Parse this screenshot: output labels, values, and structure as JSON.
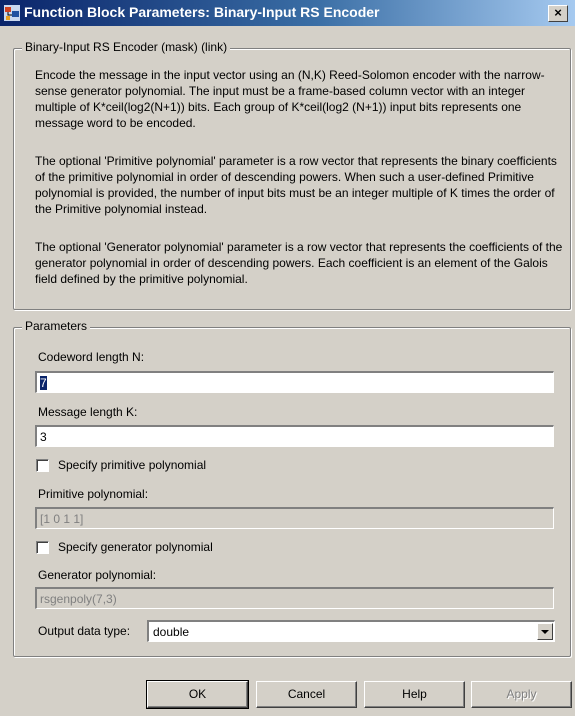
{
  "window": {
    "title": "Function Block Parameters: Binary-Input RS Encoder",
    "close_label": "×"
  },
  "description": {
    "group_label": "Binary-Input RS Encoder (mask) (link)",
    "paragraphs": [
      "Encode the message in the input vector using an (N,K) Reed-Solomon encoder with the narrow-sense generator polynomial.  The input must be a frame-based column vector with an integer multiple of K*ceil(log2(N+1)) bits.  Each group of K*ceil(log2 (N+1)) input bits represents one message word to be encoded.",
      "The optional 'Primitive polynomial' parameter is a row vector that represents the binary coefficients of the primitive polynomial in order of descending powers.  When such a user-defined Primitive polynomial is provided, the number of input bits must be an integer multiple of K times the order of the Primitive polynomial instead.",
      "The optional 'Generator polynomial' parameter is a row vector that represents the coefficients of the generator polynomial in order of descending powers.  Each coefficient is an element of the Galois field defined by the primitive polynomial."
    ]
  },
  "parameters": {
    "group_label": "Parameters",
    "codeword_length": {
      "label": "Codeword length N:",
      "value": "7"
    },
    "message_length": {
      "label": "Message length K:",
      "value": "3"
    },
    "specify_primitive": {
      "label": "Specify primitive polynomial",
      "checked": false
    },
    "primitive_polynomial": {
      "label": "Primitive polynomial:",
      "value": "[1 0 1 1]"
    },
    "specify_generator": {
      "label": "Specify generator polynomial",
      "checked": false
    },
    "generator_polynomial": {
      "label": "Generator polynomial:",
      "value": "rsgenpoly(7,3)"
    },
    "output_data_type": {
      "label": "Output data type:",
      "value": "double"
    }
  },
  "buttons": {
    "ok": "OK",
    "cancel": "Cancel",
    "help": "Help",
    "apply": "Apply"
  }
}
